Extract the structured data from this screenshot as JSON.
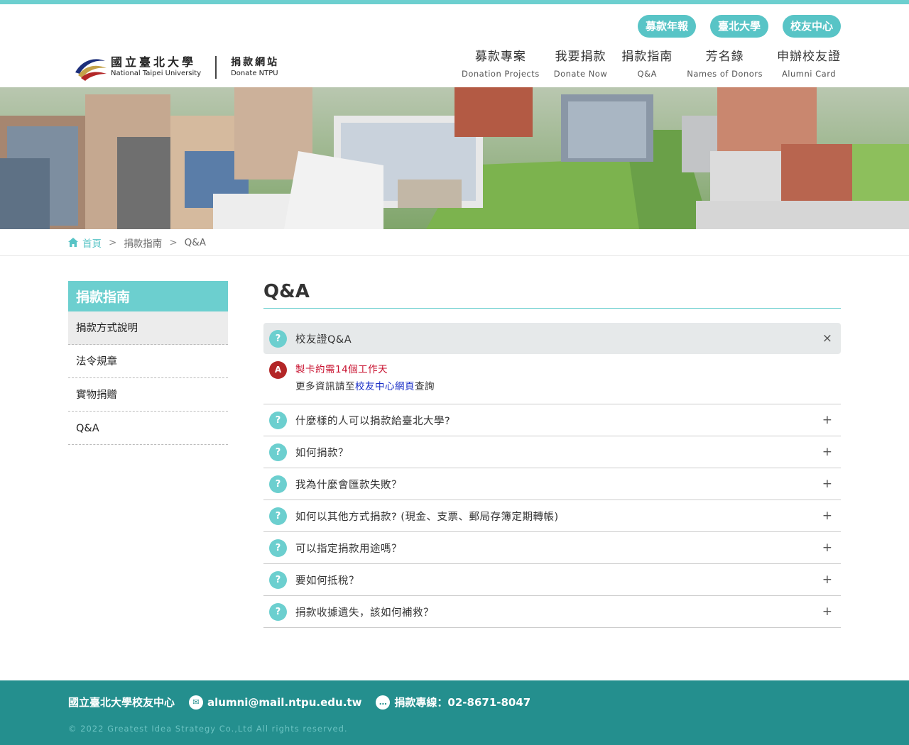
{
  "header": {
    "logo_zh": "國立臺北大學",
    "logo_en": "National Taipei University",
    "site_zh": "捐款網站",
    "site_en": "Donate NTPU",
    "pills": [
      "募款年報",
      "臺北大學",
      "校友中心"
    ],
    "nav": [
      {
        "zh": "募款專案",
        "en": "Donation Projects"
      },
      {
        "zh": "我要捐款",
        "en": "Donate Now"
      },
      {
        "zh": "捐款指南",
        "en": "Q&A"
      },
      {
        "zh": "芳名錄",
        "en": "Names of Donors"
      },
      {
        "zh": "申辦校友證",
        "en": "Alumni Card"
      }
    ]
  },
  "breadcrumb": {
    "home": "首頁",
    "level1": "捐款指南",
    "level2": "Q&A"
  },
  "sidebar": {
    "title": "捐款指南",
    "items": [
      "捐款方式說明",
      "法令規章",
      "實物捐贈",
      "Q&A"
    ]
  },
  "main": {
    "title": "Q&A",
    "open_question": {
      "mark": "?",
      "question": "校友證Q&A",
      "toggle": "×",
      "answer_mark": "A",
      "answer_line1": "製卡約需14個工作天",
      "answer_line2_before": "更多資訊請至",
      "answer_line2_link": "校友中心網頁",
      "answer_line2_after": "查詢"
    },
    "questions": [
      "什麼樣的人可以捐款給臺北大學?",
      "如何捐款？",
      "我為什麼會匯款失敗？",
      "如何以其他方式捐款? (現金、支票、郵局存簿定期轉帳)",
      "可以指定捐款用途嗎？",
      "要如何抵稅？",
      "捐款收據遺失，該如何補救？"
    ],
    "question_mark": "?",
    "expand_symbol": "+"
  },
  "footer": {
    "org": "國立臺北大學校友中心",
    "email": "alumni@mail.ntpu.edu.tw",
    "phone": "捐款專線：02-8671-8047",
    "copyright": "© 2022 Greatest Idea Strategy Co.,Ltd All rights reserved."
  },
  "colors": {
    "accent": "#6ccfcf",
    "footer": "#248f8e",
    "answer_red": "#c8102e",
    "answer_mark": "#b32627"
  }
}
